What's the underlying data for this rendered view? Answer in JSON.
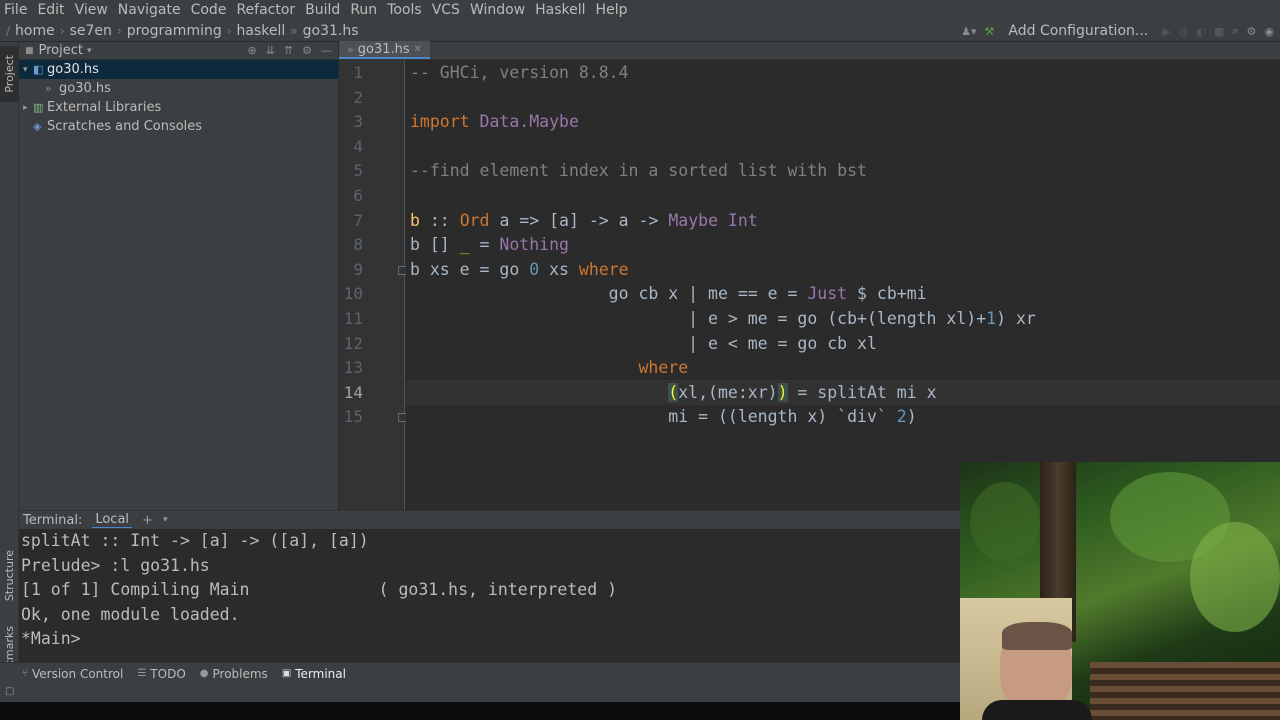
{
  "menu": [
    "File",
    "Edit",
    "View",
    "Navigate",
    "Code",
    "Refactor",
    "Build",
    "Run",
    "Tools",
    "VCS",
    "Window",
    "Haskell",
    "Help"
  ],
  "breadcrumbs": [
    "home",
    "se7en",
    "programming",
    "haskell",
    "go31.hs"
  ],
  "run_config": {
    "label": "Add Configuration..."
  },
  "sidebar": {
    "project_tab": "Project",
    "structure_tab": "Structure",
    "bookmarks_tab": "Bookmarks"
  },
  "project": {
    "title": "Project",
    "tree": [
      {
        "label": "go30.hs",
        "selected": true
      },
      {
        "label": "go30.hs",
        "selected": false
      },
      {
        "label": "External Libraries",
        "selected": false
      },
      {
        "label": "Scratches and Consoles",
        "selected": false
      }
    ]
  },
  "editor": {
    "tab": "go31.hs",
    "current_line": 14,
    "line_numbers": [
      "1",
      "2",
      "3",
      "4",
      "5",
      "6",
      "7",
      "8",
      "9",
      "10",
      "11",
      "12",
      "13",
      "14",
      "15"
    ],
    "lines": [
      [
        [
          "c",
          "-- GHCi, version 8.8.4"
        ]
      ],
      [],
      [
        [
          "k",
          "import "
        ],
        [
          "t",
          "Data.Maybe"
        ]
      ],
      [],
      [
        [
          "c",
          "--find element index in a sorted list with bst"
        ]
      ],
      [],
      [
        [
          "f",
          "b"
        ],
        [
          "o",
          " :: "
        ],
        [
          "k",
          "Ord "
        ],
        [
          "o",
          "a => [a] -> a -> "
        ],
        [
          "t",
          "Maybe Int"
        ]
      ],
      [
        [
          "o",
          "b [] "
        ],
        [
          "u",
          "_"
        ],
        [
          "o",
          " = "
        ],
        [
          "t",
          "Nothing"
        ]
      ],
      [
        [
          "o",
          "b xs e = go "
        ],
        [
          "n",
          "0"
        ],
        [
          "o",
          " xs "
        ],
        [
          "k",
          "where"
        ]
      ],
      [
        [
          "o",
          "                    go cb x | me == e = "
        ],
        [
          "t",
          "Just"
        ],
        [
          "o",
          " $ cb+mi"
        ]
      ],
      [
        [
          "o",
          "                            | e > me = go (cb+(length xl)+"
        ],
        [
          "n",
          "1"
        ],
        [
          "o",
          ") xr"
        ]
      ],
      [
        [
          "o",
          "                            | e < me = go cb xl"
        ]
      ],
      [
        [
          "o",
          "                       "
        ],
        [
          "k",
          "where"
        ]
      ],
      [
        [
          "o",
          "                          "
        ],
        [
          "hl",
          "("
        ],
        [
          "o",
          "xl,(me:xr)"
        ],
        [
          "hl",
          ")"
        ],
        [
          "o",
          " = splitAt mi x"
        ]
      ],
      [
        [
          "o",
          "                          mi = ((length x) `div` "
        ],
        [
          "n",
          "2"
        ],
        [
          "o",
          ")"
        ]
      ]
    ]
  },
  "terminal": {
    "title": "Terminal:",
    "tab": "Local",
    "lines": [
      "splitAt :: Int -> [a] -> ([a], [a])",
      "Prelude> :l go31.hs",
      "[1 of 1] Compiling Main             ( go31.hs, interpreted )",
      "Ok, one module loaded.",
      "*Main> "
    ]
  },
  "bottom_tools": [
    "Version Control",
    "TODO",
    "Problems",
    "Terminal"
  ],
  "colors": {
    "comment": "#808080",
    "keyword": "#cc7832",
    "type": "#9876aa",
    "function": "#ffc66d",
    "number": "#6897bb",
    "text": "#a9b7c6"
  }
}
